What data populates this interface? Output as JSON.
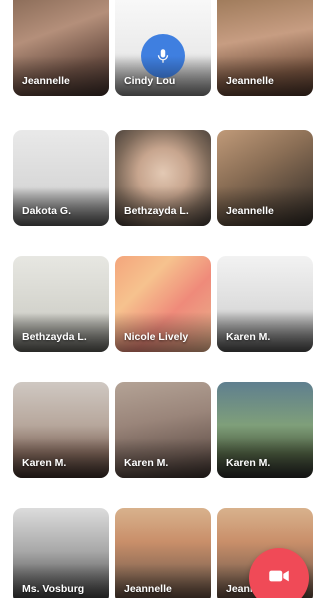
{
  "tiles": [
    {
      "name": "Jeannelle",
      "bg": "room",
      "icon": ""
    },
    {
      "name": "Cindy Lou",
      "bg": "white",
      "icon": "microphone-icon"
    },
    {
      "name": "Jeannelle",
      "bg": "room2",
      "icon": ""
    },
    {
      "name": "Dakota G.",
      "bg": "doc",
      "icon": ""
    },
    {
      "name": "Bethzayda L.",
      "bg": "face",
      "icon": ""
    },
    {
      "name": "Jeannelle",
      "bg": "cat",
      "icon": ""
    },
    {
      "name": "Bethzayda L.",
      "bg": "paper",
      "icon": ""
    },
    {
      "name": "Nicole Lively",
      "bg": "notes",
      "icon": ""
    },
    {
      "name": "Karen M.",
      "bg": "screen",
      "icon": ""
    },
    {
      "name": "Karen M.",
      "bg": "bed",
      "icon": ""
    },
    {
      "name": "Karen M.",
      "bg": "face2",
      "icon": ""
    },
    {
      "name": "Karen M.",
      "bg": "tv",
      "icon": ""
    },
    {
      "name": "Ms. Vosburg",
      "bg": "bw",
      "icon": ""
    },
    {
      "name": "Jeannelle",
      "bg": "shelf",
      "icon": ""
    },
    {
      "name": "Jeannelle",
      "bg": "shelf",
      "icon": ""
    }
  ],
  "colors": {
    "mic_circle": "#3f7fe0",
    "record_button": "#f04a57"
  },
  "fab_icon": "video-camera-icon"
}
